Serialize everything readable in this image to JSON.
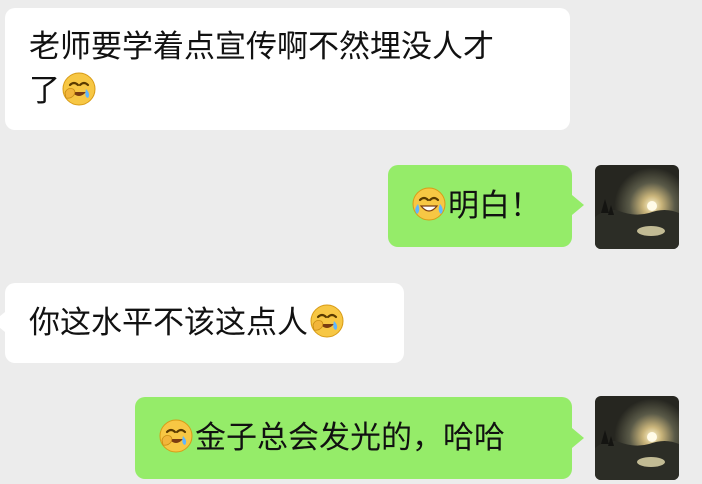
{
  "chat": {
    "messages": [
      {
        "side": "left",
        "text_line1": "老师要学着点宣传啊不然埋没人才",
        "text_line2": "了",
        "emoji": "crying-laughing"
      },
      {
        "side": "right",
        "emoji": "tears-of-joy",
        "text": "明白！"
      },
      {
        "side": "left",
        "text": "你这水平不该这点人",
        "emoji": "crying-laughing"
      },
      {
        "side": "right",
        "emoji": "crying-laughing",
        "text": "金子总会发光的，哈哈"
      }
    ]
  },
  "colors": {
    "background": "#ececec",
    "incoming_bubble": "#ffffff",
    "outgoing_bubble": "#95ec69"
  },
  "avatar": {
    "description_icon": "sunset-lake-avatar"
  }
}
